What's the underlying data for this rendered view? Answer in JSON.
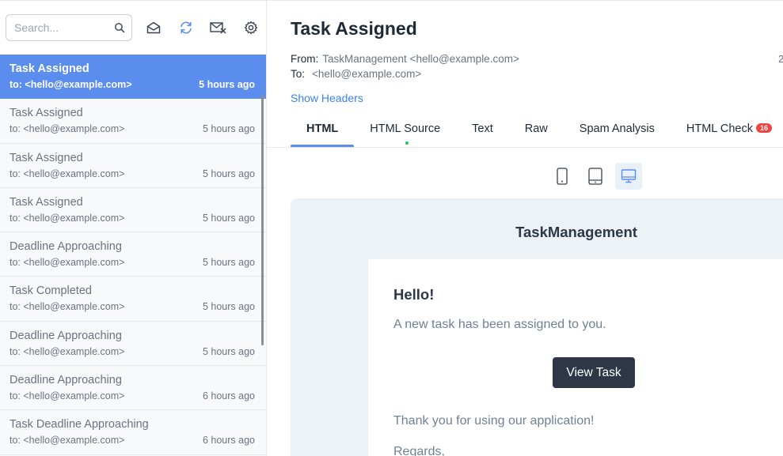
{
  "search": {
    "placeholder": "Search..."
  },
  "toolbar_icons": [
    "search-icon",
    "mail-open-icon",
    "refresh-icon",
    "mail-delete-icon",
    "gear-icon"
  ],
  "messages": [
    {
      "subject": "Task Assigned",
      "to": "to: <hello@example.com>",
      "time": "5 hours ago",
      "active": true
    },
    {
      "subject": "Task Assigned",
      "to": "to: <hello@example.com>",
      "time": "5 hours ago"
    },
    {
      "subject": "Task Assigned",
      "to": "to: <hello@example.com>",
      "time": "5 hours ago"
    },
    {
      "subject": "Task Assigned",
      "to": "to: <hello@example.com>",
      "time": "5 hours ago"
    },
    {
      "subject": "Deadline Approaching",
      "to": "to: <hello@example.com>",
      "time": "5 hours ago"
    },
    {
      "subject": "Task Completed",
      "to": "to: <hello@example.com>",
      "time": "5 hours ago"
    },
    {
      "subject": "Deadline Approaching",
      "to": "to: <hello@example.com>",
      "time": "5 hours ago"
    },
    {
      "subject": "Deadline Approaching",
      "to": "to: <hello@example.com>",
      "time": "6 hours ago"
    },
    {
      "subject": "Task Deadline Approaching",
      "to": "to: <hello@example.com>",
      "time": "6 hours ago"
    }
  ],
  "email": {
    "title": "Task Assigned",
    "from_label": "From:",
    "from_value": "TaskManagement <hello@example.com>",
    "to_label": "To:",
    "to_value": "<hello@example.com>",
    "date_cut": "2",
    "show_headers": "Show Headers"
  },
  "tabs": [
    {
      "label": "HTML",
      "active": true
    },
    {
      "label": "HTML Source"
    },
    {
      "label": "Text"
    },
    {
      "label": "Raw"
    },
    {
      "label": "Spam Analysis"
    },
    {
      "label": "HTML Check",
      "badge": "16"
    }
  ],
  "devices": [
    "mobile-icon",
    "tablet-icon",
    "desktop-icon"
  ],
  "preview": {
    "brand": "TaskManagement",
    "greeting": "Hello!",
    "intro": "A new task has been assigned to you.",
    "button": "View Task",
    "thanks": "Thank you for using our application!",
    "regards": "Regards,"
  },
  "colors": {
    "accent": "#5b8def",
    "link": "#3b82f6",
    "badge": "#ef4444",
    "button": "#2d3748"
  }
}
